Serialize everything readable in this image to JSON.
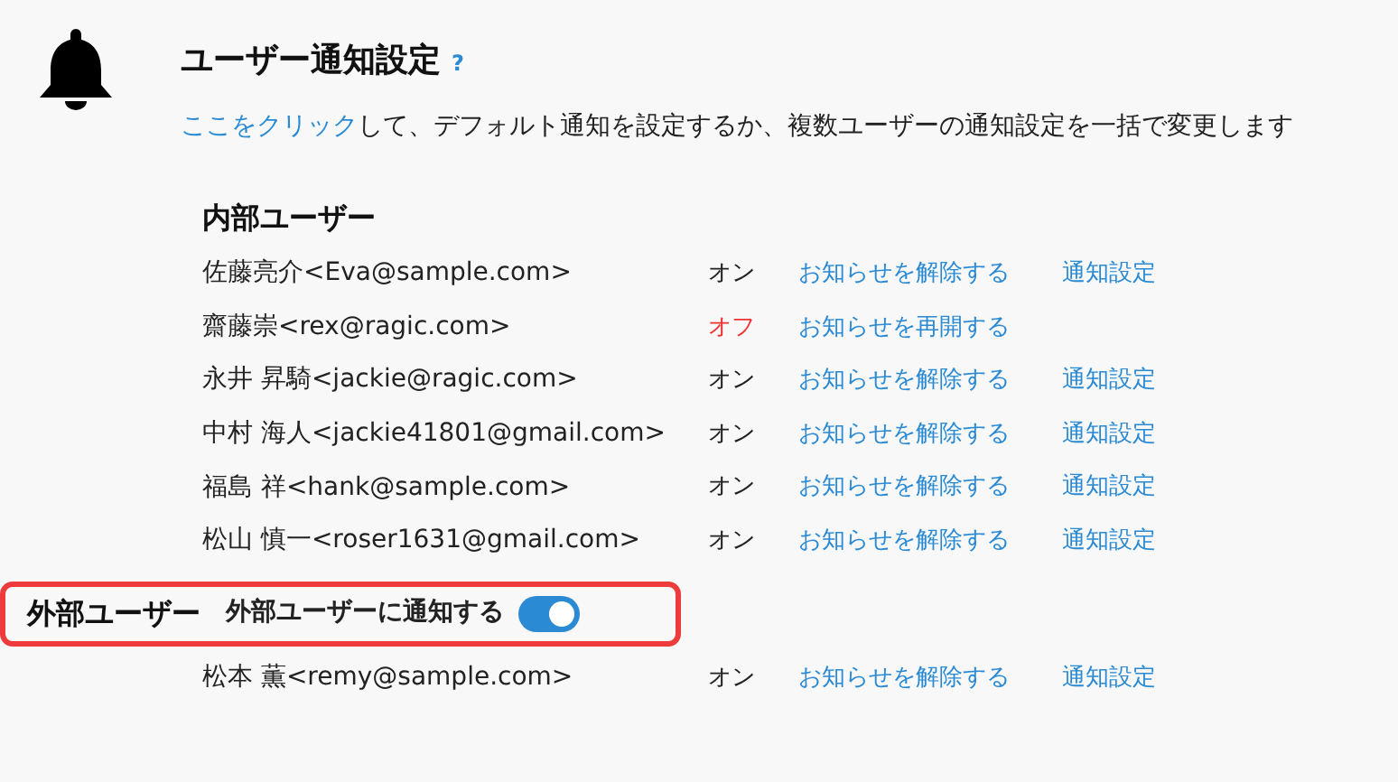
{
  "header": {
    "title": "ユーザー通知設定",
    "help": "?",
    "description": {
      "link": "ここをクリック",
      "text": "して、デフォルト通知を設定するか、複数ユーザーの通知設定を一括で変更します"
    }
  },
  "internal": {
    "heading": "内部ユーザー",
    "users": [
      {
        "name": "佐藤亮介<Eva@sample.com>",
        "on": true,
        "status": "オン",
        "action": "お知らせを解除する",
        "settings": "通知設定"
      },
      {
        "name": "齋藤崇<rex@ragic.com>",
        "on": false,
        "status": "オフ",
        "action": "お知らせを再開する"
      },
      {
        "name": "永井 昇騎<jackie@ragic.com>",
        "on": true,
        "status": "オン",
        "action": "お知らせを解除する",
        "settings": "通知設定"
      },
      {
        "name": "中村 海人<jackie41801@gmail.com>",
        "on": true,
        "status": "オン",
        "action": "お知らせを解除する",
        "settings": "通知設定"
      },
      {
        "name": "福島 祥<hank@sample.com>",
        "on": true,
        "status": "オン",
        "action": "お知らせを解除する",
        "settings": "通知設定"
      },
      {
        "name": "松山 慎一<roser1631@gmail.com>",
        "on": true,
        "status": "オン",
        "action": "お知らせを解除する",
        "settings": "通知設定"
      }
    ]
  },
  "external": {
    "heading": "外部ユーザー",
    "toggle_label": "外部ユーザーに通知する",
    "notify_external": true,
    "users": [
      {
        "name": "松本 薫<remy@sample.com>",
        "on": true,
        "status": "オン",
        "action": "お知らせを解除する",
        "settings": "通知設定"
      }
    ]
  }
}
